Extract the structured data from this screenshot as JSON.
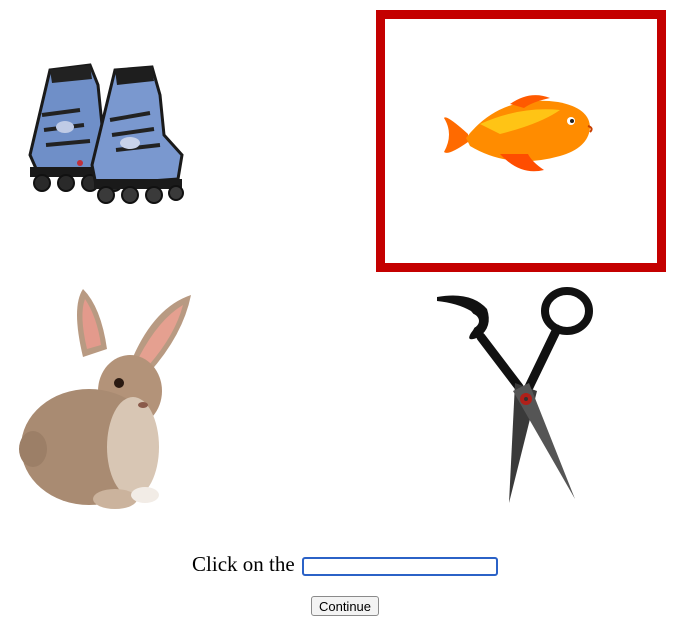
{
  "choices": [
    {
      "name": "skates",
      "icon": "inline-skates-image",
      "selected": false
    },
    {
      "name": "fish",
      "icon": "goldfish-image",
      "selected": true
    },
    {
      "name": "rabbit",
      "icon": "rabbit-image",
      "selected": false
    },
    {
      "name": "scissors",
      "icon": "scissors-image",
      "selected": false
    }
  ],
  "selection_color": "#c40000",
  "prompt": {
    "label": "Click on the",
    "input_value": ""
  },
  "continue_button": {
    "label": "Continue"
  }
}
